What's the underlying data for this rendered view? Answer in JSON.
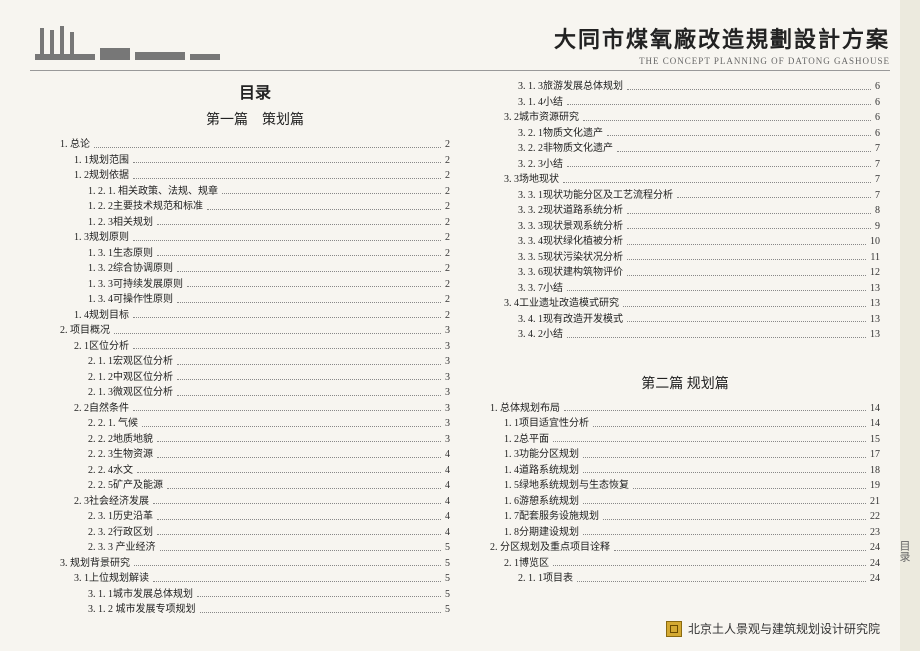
{
  "header": {
    "title_cn": "大同市煤氧廠改造規劃設計方案",
    "title_en": "THE CONCEPT PLANNING OF DATONG GASHOUSE"
  },
  "toc_heading": "目录",
  "section1": "第一篇　策划篇",
  "section2": "第二篇 规划篇",
  "sidebar": "目录",
  "footer": "北京土人景观与建筑规划设计研究院",
  "left": [
    {
      "l": "1. 总论",
      "p": "2",
      "i": 0
    },
    {
      "l": "1. 1规划范围",
      "p": "2",
      "i": 1
    },
    {
      "l": "1. 2规划依据",
      "p": "2",
      "i": 1
    },
    {
      "l": "1. 2. 1. 相关政策、法规、规章",
      "p": "2",
      "i": 2
    },
    {
      "l": "1. 2. 2主要技术规范和标准",
      "p": "2",
      "i": 2
    },
    {
      "l": "1. 2. 3相关规划",
      "p": "2",
      "i": 2
    },
    {
      "l": "1. 3规划原则",
      "p": "2",
      "i": 1
    },
    {
      "l": "1. 3. 1生态原则",
      "p": "2",
      "i": 2
    },
    {
      "l": "1. 3. 2综合协调原则",
      "p": "2",
      "i": 2
    },
    {
      "l": "1. 3. 3可持续发展原则",
      "p": "2",
      "i": 2
    },
    {
      "l": "1. 3. 4可操作性原则",
      "p": "2",
      "i": 2
    },
    {
      "l": "1. 4规划目标",
      "p": "2",
      "i": 1
    },
    {
      "l": "2. 项目概况",
      "p": "3",
      "i": 0
    },
    {
      "l": "2. 1区位分析",
      "p": "3",
      "i": 1
    },
    {
      "l": "2. 1. 1宏观区位分析",
      "p": "3",
      "i": 2
    },
    {
      "l": "2. 1. 2中观区位分析",
      "p": "3",
      "i": 2
    },
    {
      "l": "2. 1. 3微观区位分析",
      "p": "3",
      "i": 2
    },
    {
      "l": "2. 2自然条件",
      "p": "3",
      "i": 1
    },
    {
      "l": "2. 2. 1. 气候",
      "p": "3",
      "i": 2
    },
    {
      "l": "2. 2. 2地质地貌",
      "p": "3",
      "i": 2
    },
    {
      "l": "2. 2. 3生物资源",
      "p": "4",
      "i": 2
    },
    {
      "l": "2. 2. 4水文",
      "p": "4",
      "i": 2
    },
    {
      "l": "2. 2. 5矿产及能源",
      "p": "4",
      "i": 2
    },
    {
      "l": "2. 3社会经济发展",
      "p": "4",
      "i": 1
    },
    {
      "l": "2. 3. 1历史沿革",
      "p": "4",
      "i": 2
    },
    {
      "l": "2. 3. 2行政区划",
      "p": "4",
      "i": 2
    },
    {
      "l": "2. 3. 3 产业经济",
      "p": "5",
      "i": 2
    },
    {
      "l": "3. 规划背景研究",
      "p": "5",
      "i": 0
    },
    {
      "l": "3. 1上位规划解读",
      "p": "5",
      "i": 1
    },
    {
      "l": "3. 1. 1城市发展总体规划",
      "p": "5",
      "i": 2
    },
    {
      "l": "3. 1. 2 城市发展专项规划",
      "p": "5",
      "i": 2
    }
  ],
  "right_top": [
    {
      "l": "3. 1. 3旅游发展总体规划",
      "p": "6",
      "i": 2
    },
    {
      "l": "3. 1. 4小结",
      "p": "6",
      "i": 2
    },
    {
      "l": "3. 2城市资源研究",
      "p": "6",
      "i": 1
    },
    {
      "l": "3. 2. 1物质文化遗产",
      "p": "6",
      "i": 2
    },
    {
      "l": "3. 2. 2非物质文化遗产",
      "p": "7",
      "i": 2
    },
    {
      "l": "3. 2. 3小结",
      "p": "7",
      "i": 2
    },
    {
      "l": "3. 3场地现状",
      "p": "7",
      "i": 1
    },
    {
      "l": "3. 3. 1现状功能分区及工艺流程分析",
      "p": "7",
      "i": 2
    },
    {
      "l": "3. 3. 2现状道路系统分析",
      "p": "8",
      "i": 2
    },
    {
      "l": "3. 3. 3现状景观系统分析",
      "p": "9",
      "i": 2
    },
    {
      "l": "3. 3. 4现状绿化植被分析",
      "p": "10",
      "i": 2
    },
    {
      "l": "3. 3. 5现状污染状况分析",
      "p": "11",
      "i": 2
    },
    {
      "l": "3. 3. 6现状建构筑物评价",
      "p": "12",
      "i": 2
    },
    {
      "l": "3. 3. 7小结",
      "p": "13",
      "i": 2
    },
    {
      "l": "3. 4工业遗址改造模式研究",
      "p": "13",
      "i": 1
    },
    {
      "l": "3. 4. 1现有改造开发模式",
      "p": "13",
      "i": 2
    },
    {
      "l": "3. 4. 2小结",
      "p": "13",
      "i": 2
    }
  ],
  "right_bottom": [
    {
      "l": "1. 总体规划布局",
      "p": "14",
      "i": 0
    },
    {
      "l": "1. 1项目适宜性分析",
      "p": "14",
      "i": 1
    },
    {
      "l": "1. 2总平面",
      "p": "15",
      "i": 1
    },
    {
      "l": "1. 3功能分区规划",
      "p": "17",
      "i": 1
    },
    {
      "l": "1. 4道路系统规划",
      "p": "18",
      "i": 1
    },
    {
      "l": "1. 5绿地系统规划与生态恢复",
      "p": "19",
      "i": 1
    },
    {
      "l": "1. 6游憩系统规划",
      "p": "21",
      "i": 1
    },
    {
      "l": "1. 7配套服务设施规划",
      "p": "22",
      "i": 1
    },
    {
      "l": "1. 8分期建设规划",
      "p": "23",
      "i": 1
    },
    {
      "l": "2. 分区规划及重点项目诠释",
      "p": "24",
      "i": 0
    },
    {
      "l": "2. 1博览区",
      "p": "24",
      "i": 1
    },
    {
      "l": "2. 1. 1项目表",
      "p": "24",
      "i": 2
    }
  ]
}
